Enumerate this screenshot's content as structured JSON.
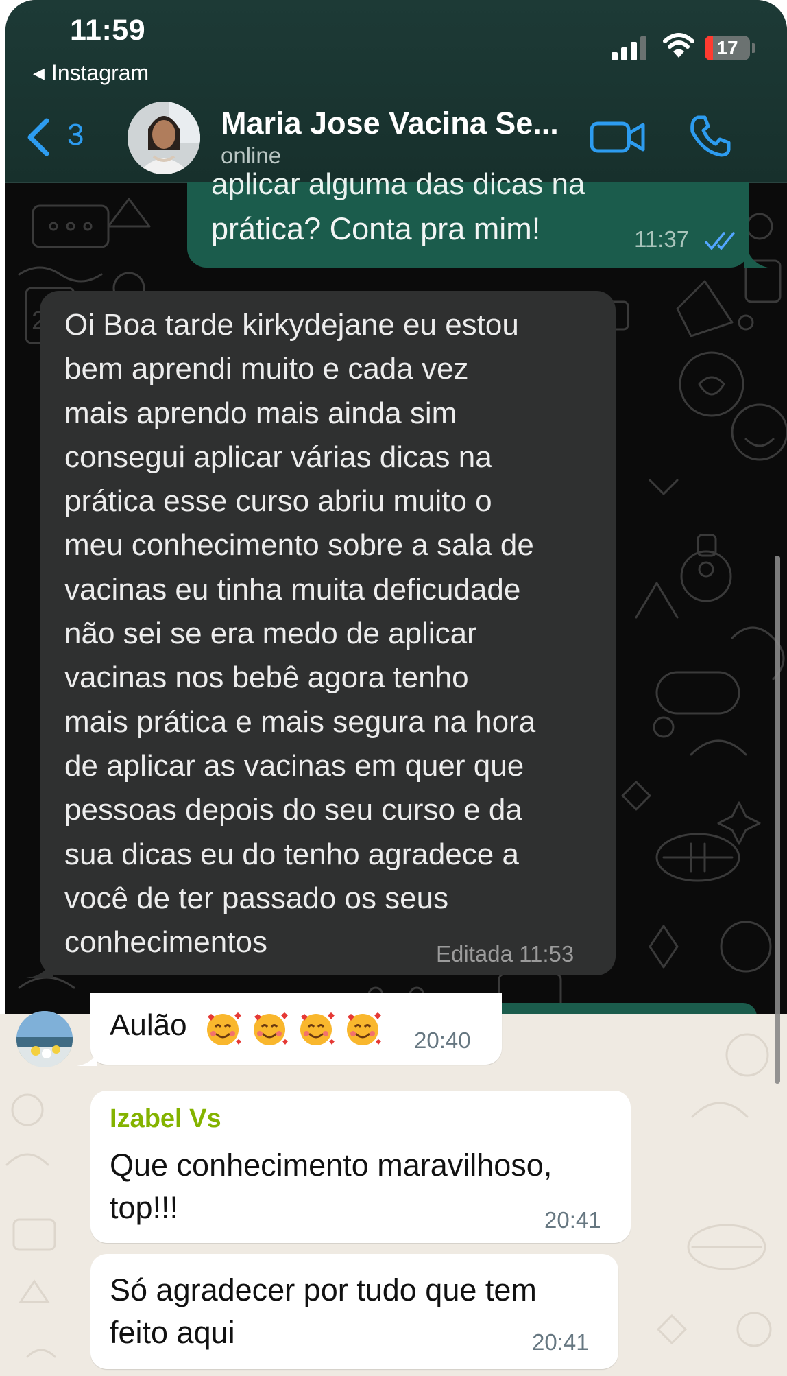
{
  "status_bar": {
    "time": "11:59",
    "back_app": "Instagram",
    "battery": "17"
  },
  "chat_header": {
    "back_count": "3",
    "contact_name": "Maria Jose Vacina Se...",
    "status": "online",
    "icons": [
      "chevron-left-icon",
      "video-call-icon",
      "phone-icon"
    ]
  },
  "dark_chat": {
    "outgoing": {
      "cut_text": "aplicar alguma das dicas na",
      "text": "prática? Conta pra mim!",
      "time": "11:37"
    },
    "incoming": {
      "text": "Oi Boa tarde kirkydejane eu estou\nbem aprendi muito e cada vez\nmais aprendo mais ainda sim\nconsegui aplicar várias dicas na\nprática esse curso abriu muito o\nmeu conhecimento sobre a sala de\nvacinas eu tinha muita deficudade\nnão sei se era medo de aplicar\nvacinas nos bebê agora tenho\nmais prática e mais segura na hora\nde aplicar as vacinas em quer que\npessoas depois do seu curso e da\nsua dicas eu do tenho agradece a\nvocê de ter passado os seus\nconhecimentos",
      "meta": "Editada 11:53"
    }
  },
  "group_chat": {
    "messages": [
      {
        "text": "Aulão",
        "emojis": "🥰🥰🥰🥰",
        "time": "20:40"
      },
      {
        "sender": "Izabel Vs",
        "text": "Que conhecimento maravilhoso,\ntop!!!",
        "time": "20:41"
      },
      {
        "text": "Só agradecer por tudo que tem\nfeito aqui",
        "time": "20:41"
      }
    ]
  },
  "colors": {
    "header_bg": "#1d3a36",
    "outgoing_bubble": "#1b5c4c",
    "incoming_bubble_dark": "#2f3030",
    "ios_blue": "#2d9cf0",
    "sender_name": "#84b300",
    "light_bg": "#efeae2"
  }
}
